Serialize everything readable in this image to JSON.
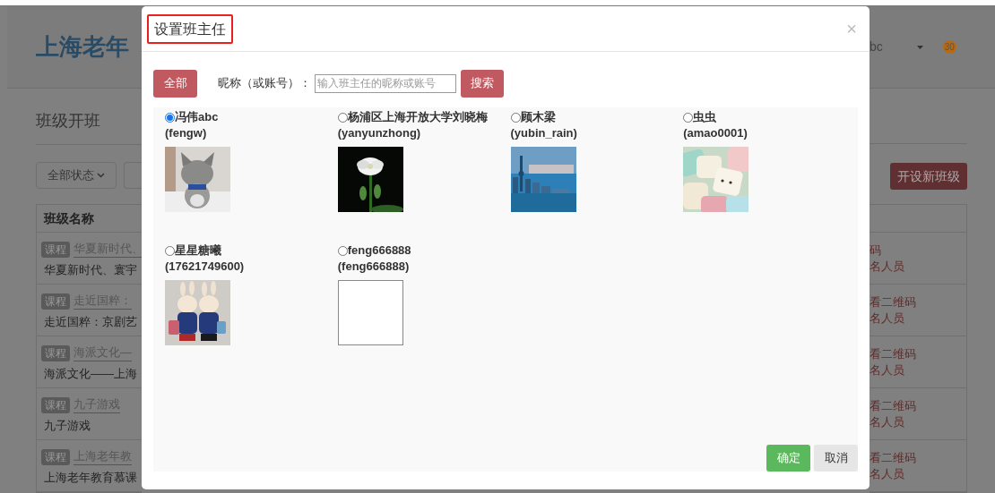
{
  "background_page": {
    "site_title": "上海老年",
    "user_name": "bc",
    "notification_count": "30",
    "page_title": "班级开班",
    "status_filter": "全部状态",
    "new_class_button": "开设新班级",
    "table": {
      "columns": [
        "班级名称"
      ],
      "rows": [
        {
          "tag": "课程",
          "course_link": "华夏新时代、",
          "class_name": "华夏新时代、寰宇",
          "actions": [
            "码",
            "名人员"
          ]
        },
        {
          "tag": "课程",
          "course_link": "走近国粹：",
          "class_name": "走近国粹：京剧艺",
          "actions": [
            "看二维码",
            "名人员"
          ]
        },
        {
          "tag": "课程",
          "course_link": "海派文化—",
          "class_name": "海派文化——上海",
          "actions": [
            "看二维码",
            "名人员"
          ]
        },
        {
          "tag": "课程",
          "course_link": "九子游戏",
          "class_name": "九子游戏",
          "actions": [
            "看二维码",
            "名人员"
          ]
        },
        {
          "tag": "课程",
          "course_link": "上海老年教",
          "class_name": "上海老年教育慕课",
          "actions": [
            "看二维码",
            "名人员"
          ]
        }
      ]
    }
  },
  "dialog": {
    "title": "设置班主任",
    "close": "×",
    "all_button": "全部",
    "search_label": "昵称（或账号）：",
    "search_field": {
      "placeholder": "输入班主任的昵称或账号"
    },
    "search_button": "搜索",
    "teachers": [
      {
        "name": "冯伟abc",
        "account": "(fengw)",
        "selected": true,
        "kind": "picture"
      },
      {
        "name": "杨浦区上海开放大学刘晓梅",
        "account": "(yanyunzhong)",
        "selected": false,
        "kind": "picture"
      },
      {
        "name": "顾木梁",
        "account": "(yubin_rain)",
        "selected": false,
        "kind": "picture"
      },
      {
        "name": "虫虫",
        "account": "(amao0001)",
        "selected": false,
        "kind": "picture"
      },
      {
        "name": "星星糖曦",
        "account": "(17621749600)",
        "selected": false,
        "kind": "picture"
      },
      {
        "name": "feng666888",
        "account": "(feng666888)",
        "selected": false,
        "kind": "empty"
      }
    ],
    "buttons": [
      {
        "label": "确定",
        "kind": "primary"
      },
      {
        "label": "取消",
        "kind": "secondary"
      }
    ]
  }
}
